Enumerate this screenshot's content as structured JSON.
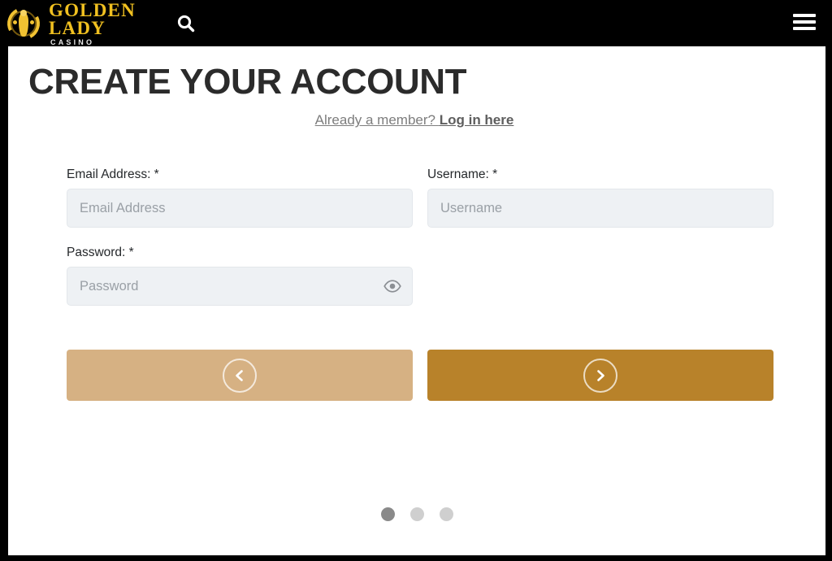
{
  "header": {
    "logo": {
      "line1": "GOLDEN",
      "line2": "LADY",
      "subtitle": "CASINO",
      "emblem_icon": "golden-lady-emblem-icon",
      "gold_color": "#f0c020"
    },
    "search_icon": "search-icon",
    "menu_icon": "hamburger-menu-icon",
    "background": "#000000"
  },
  "main": {
    "title": "CREATE YOUR ACCOUNT",
    "login_prompt": {
      "text": "Already a member?",
      "link_label": "Log in here"
    },
    "fields": [
      {
        "name": "email",
        "label": "Email Address: *",
        "placeholder": "Email Address",
        "value": ""
      },
      {
        "name": "username",
        "label": "Username: *",
        "placeholder": "Username",
        "value": ""
      },
      {
        "name": "password",
        "label": "Password: *",
        "placeholder": "Password",
        "value": "",
        "toggle_icon": "eye-icon"
      }
    ],
    "buttons": {
      "back": {
        "icon": "chevron-left-icon",
        "color": "#d6b183"
      },
      "next": {
        "icon": "chevron-right-icon",
        "color": "#b8822a"
      }
    },
    "pager": {
      "total": 3,
      "active_index": 0,
      "active_color": "#8a8a8a",
      "inactive_color": "#cfcfcf"
    }
  }
}
